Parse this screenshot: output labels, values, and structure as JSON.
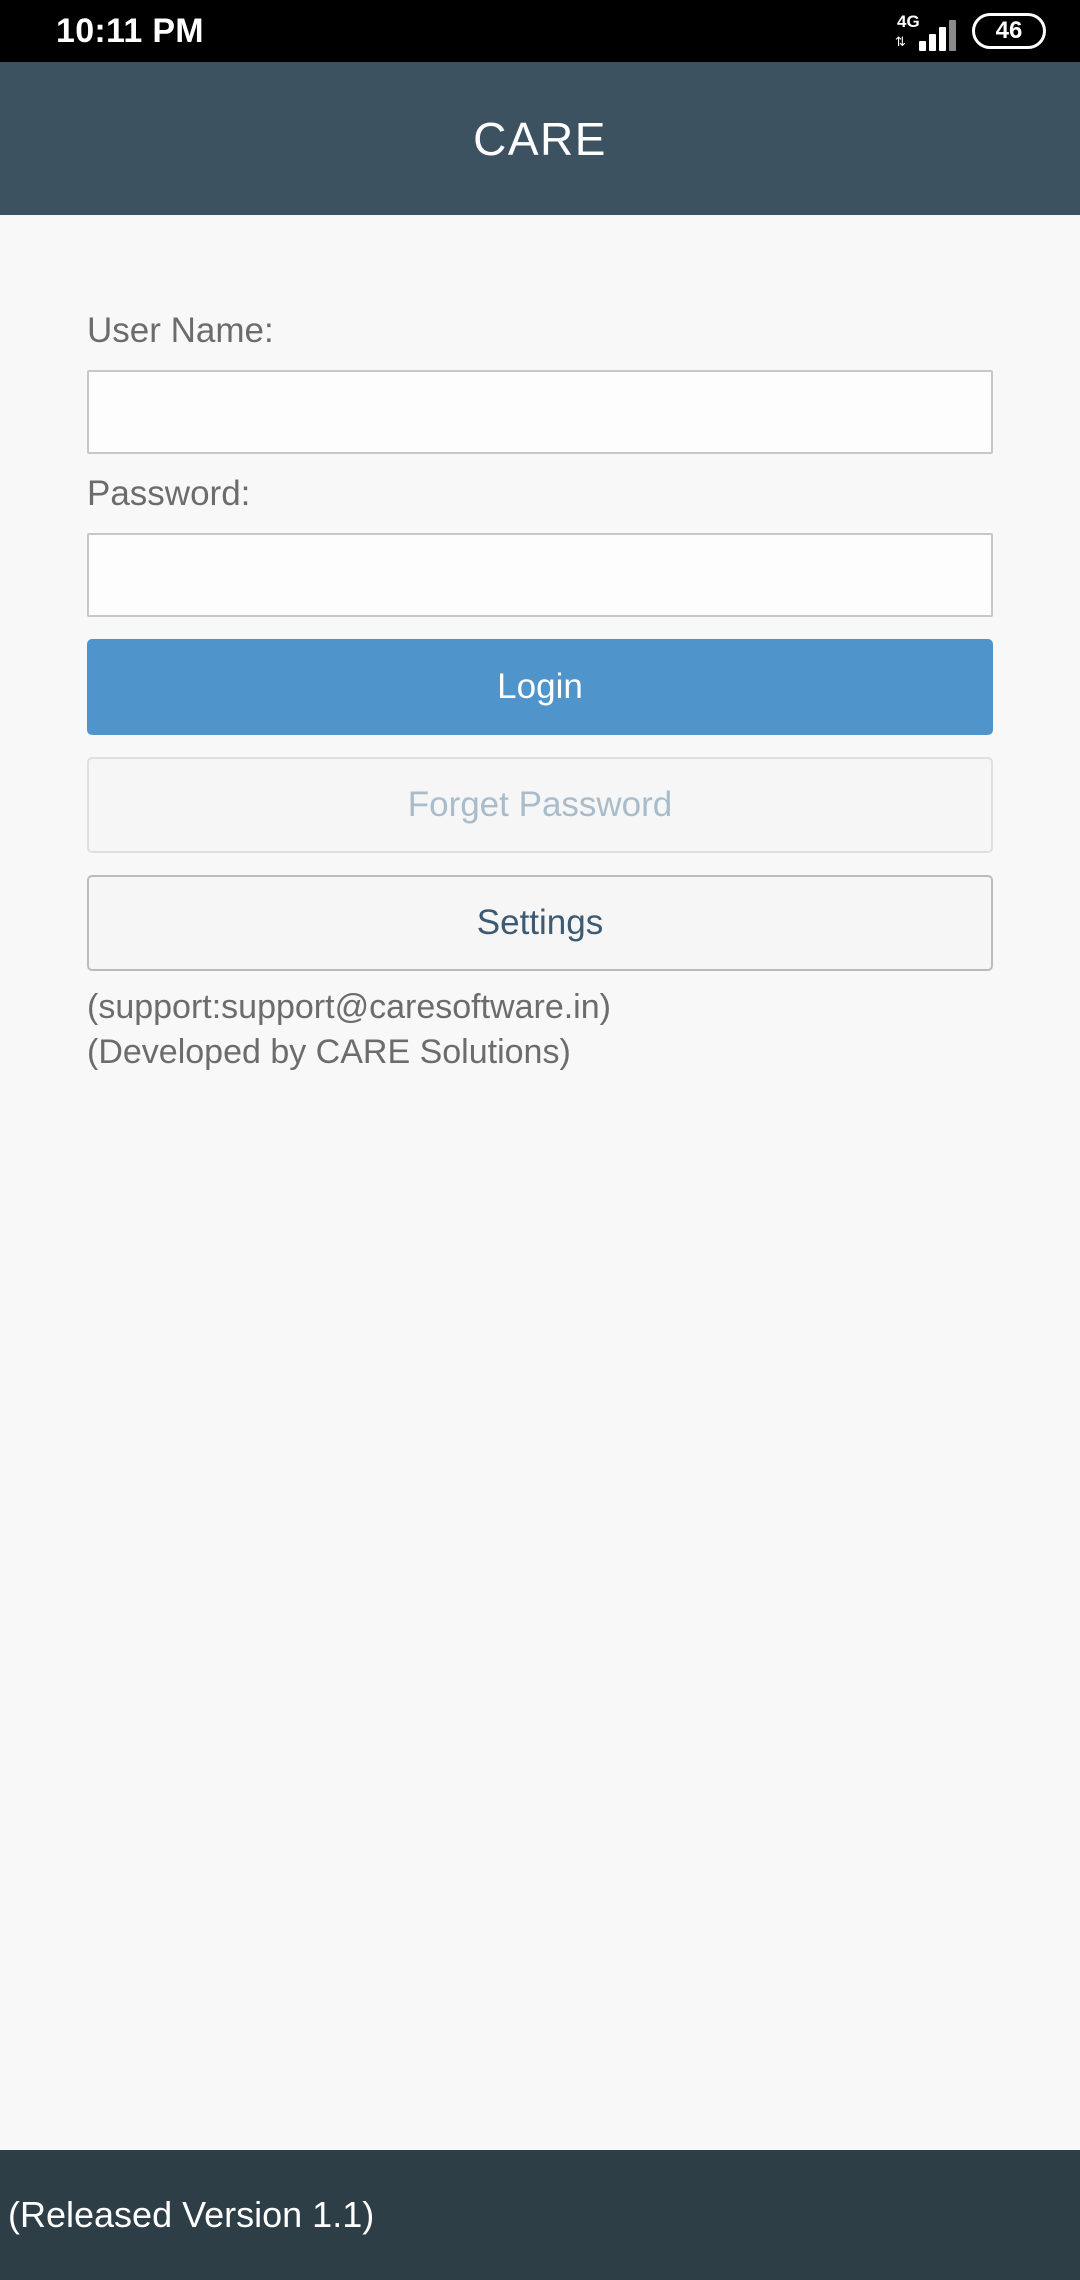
{
  "status_bar": {
    "time": "10:11 PM",
    "network_type": "4G",
    "data_arrows": "⇅",
    "battery_level": "46",
    "signal_bars_total": 4,
    "signal_bars_active": 3,
    "colors": {
      "background": "#000000",
      "foreground": "#FFFFFF"
    }
  },
  "app_bar": {
    "title": "CARE",
    "colors": {
      "background": "#3D5261",
      "text": "#FFFFFF"
    }
  },
  "form": {
    "username": {
      "label": "User Name:",
      "value": "",
      "placeholder": ""
    },
    "password": {
      "label": "Password:",
      "value": "",
      "placeholder": ""
    }
  },
  "buttons": {
    "login": {
      "label": "Login",
      "background": "#4F95CB",
      "text_color": "#FFFFFF"
    },
    "forget_password": {
      "label": "Forget Password",
      "background": "#F5F6F5",
      "text_color": "#A8BCCB"
    },
    "settings": {
      "label": "Settings",
      "background": "#F5F6F5",
      "text_color": "#3D5A72"
    }
  },
  "info": {
    "support": "(support:support@caresoftware.in)",
    "developer": "(Developed by CARE Solutions)"
  },
  "footer": {
    "version_text": "(Released Version 1.1)",
    "colors": {
      "background": "#2E3E47",
      "text": "#FFFFFF"
    }
  },
  "page": {
    "background": "#F7F8F7"
  }
}
